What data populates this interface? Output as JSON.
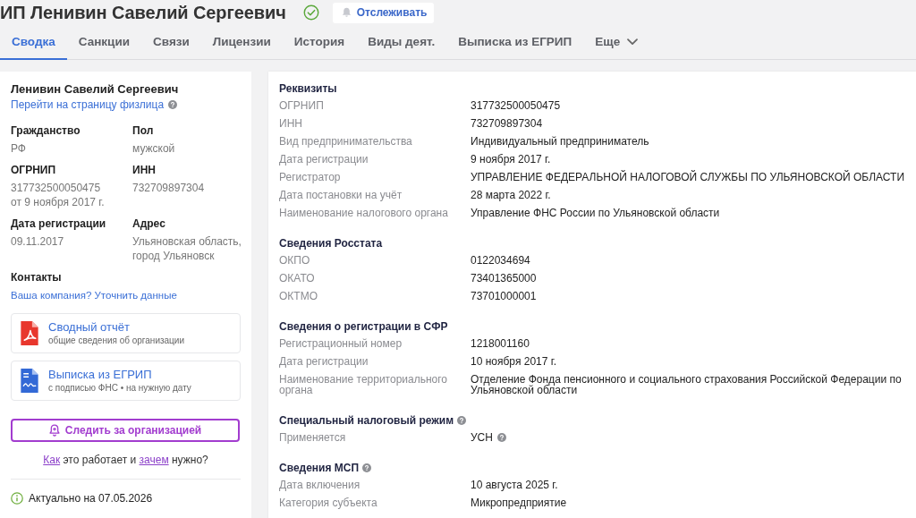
{
  "header": {
    "title": "ИП Ленивин Савелий Сергеевич",
    "follow_button": "Отслеживать"
  },
  "tabs": [
    {
      "label": "Сводка",
      "selected": true,
      "kind": "plain"
    },
    {
      "label": "Санкции",
      "selected": false,
      "kind": "plain"
    },
    {
      "label": "Связи",
      "selected": false,
      "kind": "plain"
    },
    {
      "label": "Лицензии",
      "selected": false,
      "kind": "plain"
    },
    {
      "label": "История",
      "selected": false,
      "kind": "plain"
    },
    {
      "label": "Виды деят.",
      "selected": false,
      "kind": "plain"
    },
    {
      "label": "Выписка из ЕГРИП",
      "selected": false,
      "kind": "plain"
    },
    {
      "label": "Еще",
      "selected": false,
      "kind": "dropdown"
    }
  ],
  "profile": {
    "name": "Ленивин Савелий Сергеевич",
    "person_link": "Перейти на страницу физлица",
    "fields": [
      {
        "label": "Гражданство",
        "values": [
          "РФ"
        ]
      },
      {
        "label": "Пол",
        "values": [
          "мужской"
        ]
      },
      {
        "label": "ОГРНИП",
        "values": [
          "317732500050475",
          "от 9 ноября 2017 г."
        ]
      },
      {
        "label": "ИНН",
        "values": [
          "732709897304"
        ]
      },
      {
        "label": "Дата регистрации",
        "values": [
          "09.11.2017"
        ]
      },
      {
        "label": "Адрес",
        "values": [
          "Ульяновская область, город Ульяновск"
        ]
      }
    ],
    "contacts_title": "Контакты",
    "contacts_link": "Ваша компания? Уточнить данные"
  },
  "documents": [
    {
      "kind": "pdf",
      "title": "Сводный отчёт",
      "subtitle": "общие сведения об организации"
    },
    {
      "kind": "signed",
      "title": "Выписка из ЕГРИП",
      "subtitle": "с подписью ФНС • на нужную дату"
    }
  ],
  "watch_button": "Следить за организацией",
  "help_line": [
    {
      "kind": "link",
      "text": "Как"
    },
    {
      "kind": "text",
      "text": "это работает и"
    },
    {
      "kind": "link",
      "text": "зачем"
    },
    {
      "kind": "text",
      "text": "нужно?"
    }
  ],
  "actuality": "Актуально на 07.05.2026",
  "sections": [
    {
      "title": "Реквизиты",
      "help": false,
      "rows": [
        {
          "label": "ОГРНИП",
          "value": "317732500050475",
          "help": false
        },
        {
          "label": "ИНН",
          "value": "732709897304",
          "help": false
        },
        {
          "label": "Вид предпринимательства",
          "value": "Индивидуальный предприниматель",
          "help": false
        },
        {
          "label": "Дата регистрации",
          "value": "9 ноября 2017 г.",
          "help": false
        },
        {
          "label": "Регистратор",
          "value": "УПРАВЛЕНИЕ ФЕДЕРАЛЬНОЙ НАЛОГОВОЙ СЛУЖБЫ ПО УЛЬЯНОВСКОЙ ОБЛАСТИ",
          "help": false
        },
        {
          "label": "Дата постановки на учёт",
          "value": "28 марта 2022 г.",
          "help": false
        },
        {
          "label": "Наименование налогового органа",
          "value": "Управление ФНС России по Ульяновской области",
          "help": false
        }
      ]
    },
    {
      "title": "Сведения Росстата",
      "help": false,
      "rows": [
        {
          "label": "ОКПО",
          "value": "0122034694",
          "help": false
        },
        {
          "label": "ОКАТО",
          "value": "73401365000",
          "help": false
        },
        {
          "label": "ОКТМО",
          "value": "73701000001",
          "help": false
        }
      ]
    },
    {
      "title": "Сведения о регистрации в СФР",
      "help": false,
      "rows": [
        {
          "label": "Регистрационный номер",
          "value": "1218001160",
          "help": false
        },
        {
          "label": "Дата регистрации",
          "value": "10 ноября 2017 г.",
          "help": false
        },
        {
          "label": "Наименование территориального органа",
          "value": "Отделение Фонда пенсионного и социального страхования Российской Федерации по Ульяновской области",
          "help": false
        }
      ]
    },
    {
      "title": "Специальный налоговый режим",
      "help": true,
      "rows": [
        {
          "label": "Применяется",
          "value": "УСН",
          "help": true
        }
      ]
    },
    {
      "title": "Сведения МСП",
      "help": true,
      "rows": [
        {
          "label": "Дата включения",
          "value": "10 августа 2025 г.",
          "help": false
        },
        {
          "label": "Категория субъекта",
          "value": "Микропредприятие",
          "help": false
        }
      ]
    }
  ]
}
